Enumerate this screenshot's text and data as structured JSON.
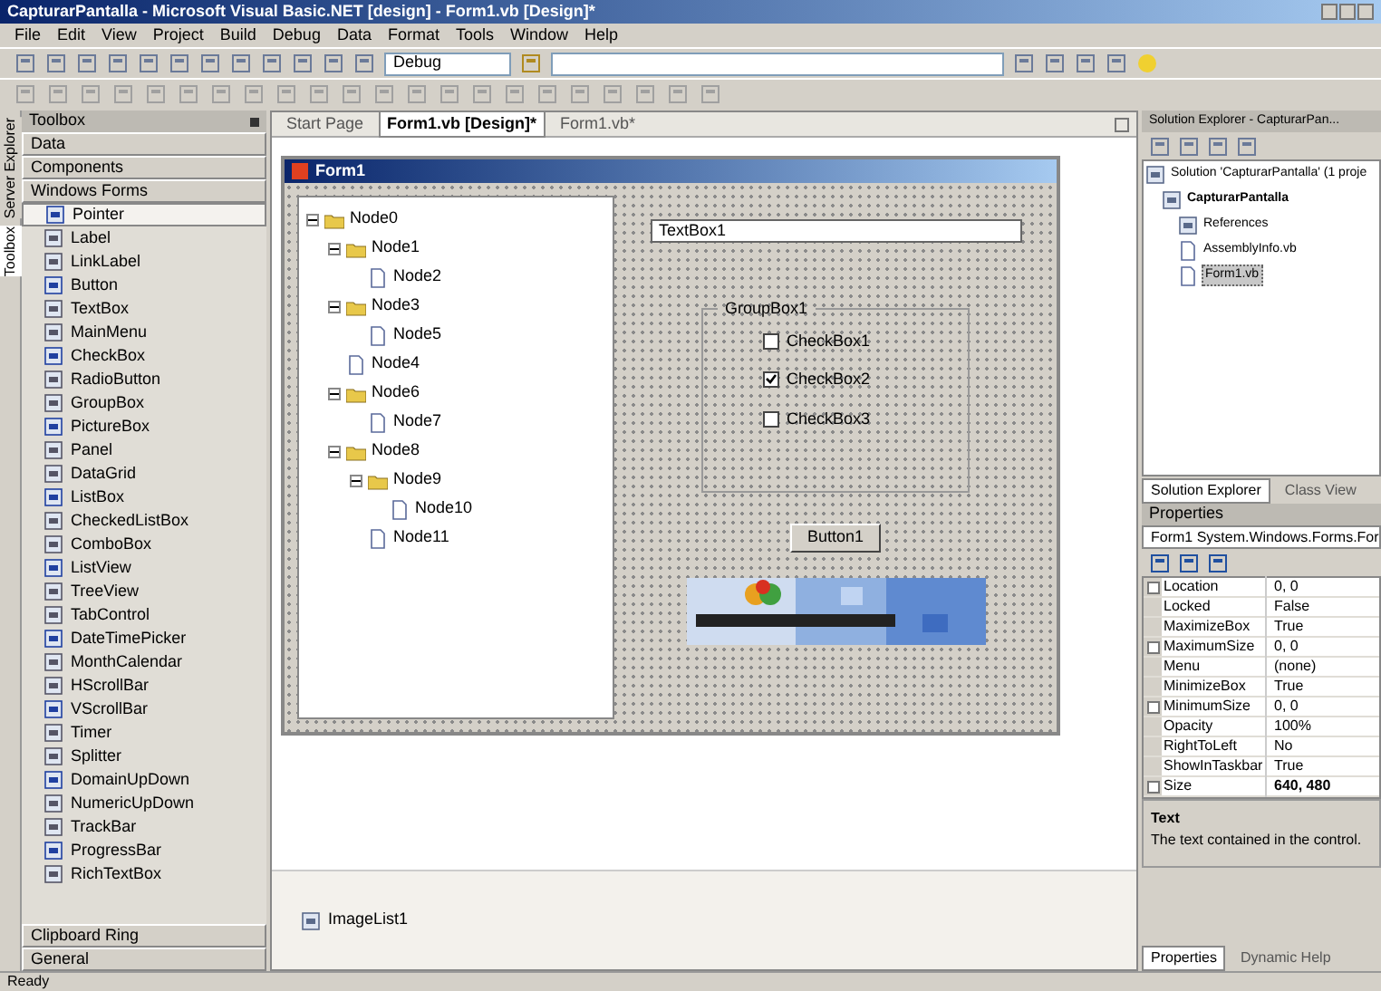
{
  "window": {
    "title": "CapturarPantalla - Microsoft Visual Basic.NET [design] - Form1.vb [Design]*"
  },
  "menu": [
    "File",
    "Edit",
    "View",
    "Project",
    "Build",
    "Debug",
    "Data",
    "Format",
    "Tools",
    "Window",
    "Help"
  ],
  "toolbar": {
    "configuration": "Debug"
  },
  "side_tabs": [
    {
      "label": "Server Explorer",
      "selected": false
    },
    {
      "label": "Toolbox",
      "selected": true
    }
  ],
  "toolbox": {
    "title": "Toolbox",
    "sections_top": [
      "Data",
      "Components",
      "Windows Forms"
    ],
    "items": [
      {
        "label": "Pointer",
        "selected": true
      },
      {
        "label": "Label",
        "selected": false
      },
      {
        "label": "LinkLabel",
        "selected": false
      },
      {
        "label": "Button",
        "selected": false
      },
      {
        "label": "TextBox",
        "selected": false
      },
      {
        "label": "MainMenu",
        "selected": false
      },
      {
        "label": "CheckBox",
        "selected": false
      },
      {
        "label": "RadioButton",
        "selected": false
      },
      {
        "label": "GroupBox",
        "selected": false
      },
      {
        "label": "PictureBox",
        "selected": false
      },
      {
        "label": "Panel",
        "selected": false
      },
      {
        "label": "DataGrid",
        "selected": false
      },
      {
        "label": "ListBox",
        "selected": false
      },
      {
        "label": "CheckedListBox",
        "selected": false
      },
      {
        "label": "ComboBox",
        "selected": false
      },
      {
        "label": "ListView",
        "selected": false
      },
      {
        "label": "TreeView",
        "selected": false
      },
      {
        "label": "TabControl",
        "selected": false
      },
      {
        "label": "DateTimePicker",
        "selected": false
      },
      {
        "label": "MonthCalendar",
        "selected": false
      },
      {
        "label": "HScrollBar",
        "selected": false
      },
      {
        "label": "VScrollBar",
        "selected": false
      },
      {
        "label": "Timer",
        "selected": false
      },
      {
        "label": "Splitter",
        "selected": false
      },
      {
        "label": "DomainUpDown",
        "selected": false
      },
      {
        "label": "NumericUpDown",
        "selected": false
      },
      {
        "label": "TrackBar",
        "selected": false
      },
      {
        "label": "ProgressBar",
        "selected": false
      },
      {
        "label": "RichTextBox",
        "selected": false
      }
    ],
    "sections_bottom": [
      "Clipboard Ring",
      "General"
    ]
  },
  "doc_tabs": [
    {
      "label": "Start Page",
      "selected": false
    },
    {
      "label": "Form1.vb [Design]*",
      "selected": true
    },
    {
      "label": "Form1.vb*",
      "selected": false
    }
  ],
  "form": {
    "title": "Form1",
    "tree": [
      {
        "label": "Node0",
        "children": [
          {
            "label": "Node1",
            "children": [
              {
                "label": "Node2"
              }
            ]
          },
          {
            "label": "Node3",
            "children": [
              {
                "label": "Node5"
              }
            ]
          },
          {
            "label": "Node4"
          },
          {
            "label": "Node6",
            "children": [
              {
                "label": "Node7"
              }
            ]
          },
          {
            "label": "Node8",
            "children": [
              {
                "label": "Node9",
                "children": [
                  {
                    "label": "Node10"
                  }
                ]
              },
              {
                "label": "Node11"
              }
            ]
          }
        ]
      }
    ],
    "textbox": "TextBox1",
    "groupbox": "GroupBox1",
    "checkboxes": [
      {
        "label": "CheckBox1",
        "checked": false
      },
      {
        "label": "CheckBox2",
        "checked": true
      },
      {
        "label": "CheckBox3",
        "checked": false
      }
    ],
    "button": "Button1"
  },
  "component_tray": [
    "ImageList1"
  ],
  "solution_explorer": {
    "title": "Solution Explorer - CapturarPan...",
    "tree": [
      {
        "label": "Solution 'CapturarPantalla' (1 proje",
        "selected": false,
        "children": [
          {
            "label": "CapturarPantalla",
            "selected": false,
            "children": [
              {
                "label": "References",
                "selected": false
              },
              {
                "label": "AssemblyInfo.vb",
                "selected": false
              },
              {
                "label": "Form1.vb",
                "selected": true
              }
            ]
          }
        ]
      }
    ],
    "tabs": [
      {
        "label": "Solution Explorer",
        "selected": true
      },
      {
        "label": "Class View",
        "selected": false
      }
    ]
  },
  "properties": {
    "title": "Properties",
    "object": "Form1 System.Windows.Forms.For",
    "rows": [
      {
        "name": "Location",
        "value": "0, 0",
        "expandable": true,
        "bold": false
      },
      {
        "name": "Locked",
        "value": "False",
        "expandable": false,
        "bold": false
      },
      {
        "name": "MaximizeBox",
        "value": "True",
        "expandable": false,
        "bold": false
      },
      {
        "name": "MaximumSize",
        "value": "0, 0",
        "expandable": true,
        "bold": false
      },
      {
        "name": "Menu",
        "value": "(none)",
        "expandable": false,
        "bold": false
      },
      {
        "name": "MinimizeBox",
        "value": "True",
        "expandable": false,
        "bold": false
      },
      {
        "name": "MinimumSize",
        "value": "0, 0",
        "expandable": true,
        "bold": false
      },
      {
        "name": "Opacity",
        "value": "100%",
        "expandable": false,
        "bold": false
      },
      {
        "name": "RightToLeft",
        "value": "No",
        "expandable": false,
        "bold": false
      },
      {
        "name": "ShowInTaskbar",
        "value": "True",
        "expandable": false,
        "bold": false
      },
      {
        "name": "Size",
        "value": "640, 480",
        "expandable": true,
        "bold": true
      }
    ],
    "description_title": "Text",
    "description": "The text contained in the control.",
    "tabs": [
      {
        "label": "Properties",
        "selected": true
      },
      {
        "label": "Dynamic Help",
        "selected": false
      }
    ]
  },
  "status_bar": "Ready"
}
